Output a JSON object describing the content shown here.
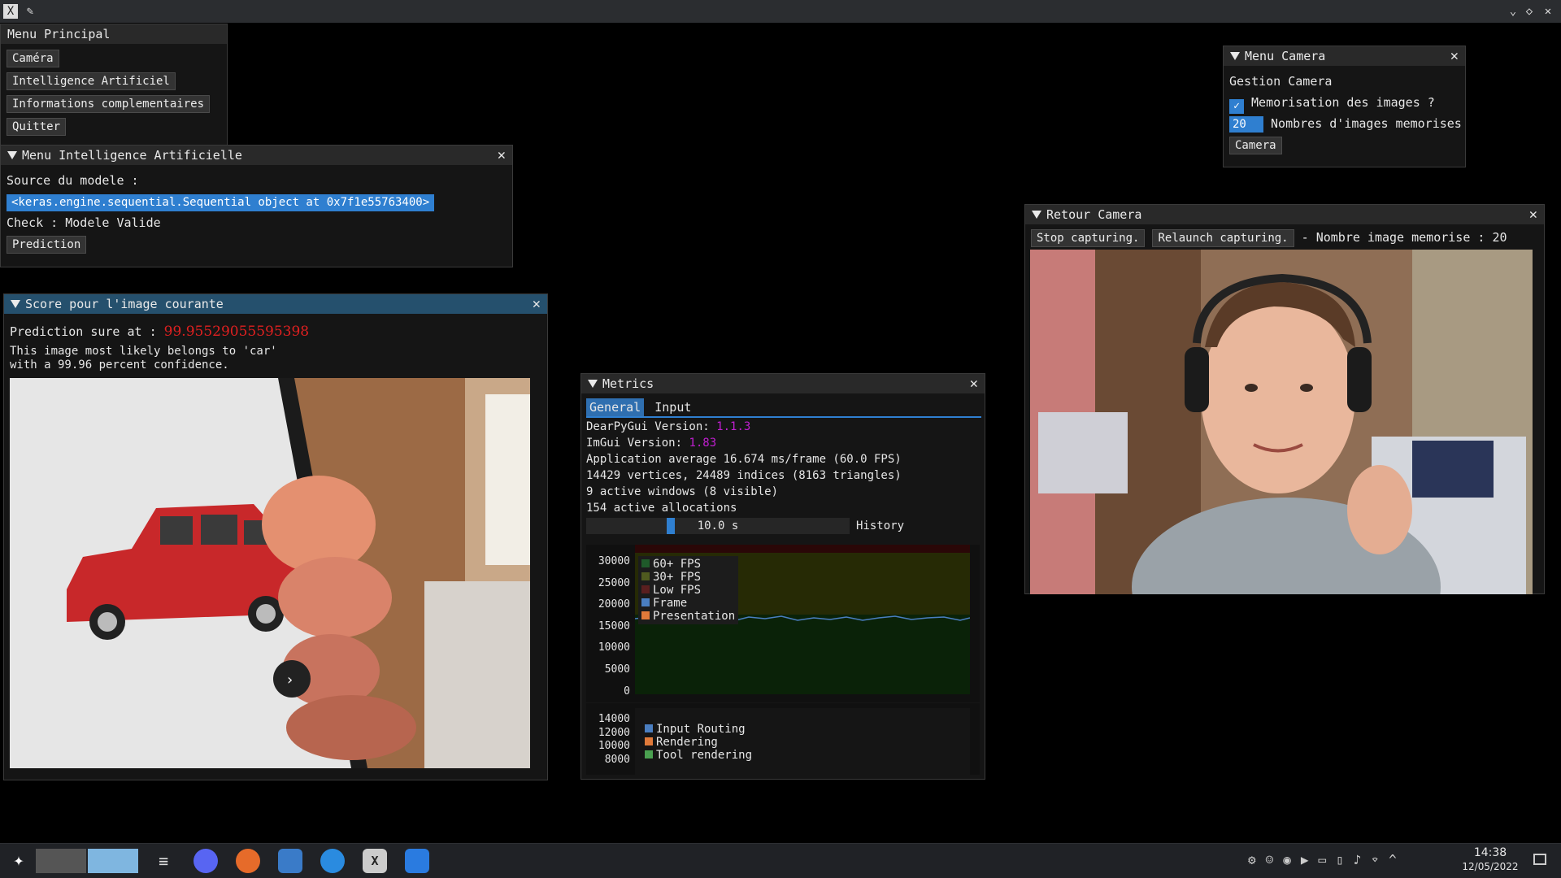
{
  "menu_principal": {
    "title": "Menu Principal",
    "buttons": [
      "Caméra",
      "Intelligence Artificiel",
      "Informations complementaires",
      "Quitter"
    ]
  },
  "menu_ia": {
    "title": "Menu Intelligence Artificielle",
    "source_label": "Source du modele :",
    "source_value": "<keras.engine.sequential.Sequential object at 0x7f1e55763400>",
    "check_label": "Check : Modele Valide",
    "prediction_button": "Prediction"
  },
  "score": {
    "title": "Score pour l'image courante",
    "prediction_label": "Prediction sure at :",
    "prediction_value": "99.95529055595398",
    "message_line1": "This image most likely belongs to 'car'",
    "message_line2": "with a 99.96 percent confidence."
  },
  "menu_camera": {
    "title": "Menu Camera",
    "section": "Gestion Camera",
    "checkbox_label": "Memorisation des images ?",
    "input_value": "20",
    "input_label": "Nombres d'images memorises",
    "button": "Camera"
  },
  "retour_camera": {
    "title": "Retour Camera",
    "stop_button": "Stop capturing.",
    "relaunch_button": "Relaunch capturing.",
    "count_text": "- Nombre image memorise : 20"
  },
  "metrics": {
    "title": "Metrics",
    "tabs": [
      "General",
      "Input"
    ],
    "dpg_label": "DearPyGui Version:",
    "dpg_version": "1.1.3",
    "imgui_label": "ImGui Version:",
    "imgui_version": "1.83",
    "avg": "Application average 16.674 ms/frame (60.0 FPS)",
    "verts": "14429 vertices, 24489 indices (8163 triangles)",
    "windows": "9 active windows (8 visible)",
    "allocs": "154 active allocations",
    "slider_value": "10.0 s",
    "history_label": "History",
    "plot1_yticks": [
      "30000",
      "25000",
      "20000",
      "15000",
      "10000",
      "5000",
      "0"
    ],
    "plot1_legend": [
      "60+ FPS",
      "30+ FPS",
      "Low FPS",
      "Frame",
      "Presentation"
    ],
    "plot2_yticks": [
      "14000",
      "12000",
      "10000",
      "8000"
    ],
    "plot2_legend": [
      "Input Routing",
      "Rendering",
      "Tool rendering"
    ]
  },
  "taskbar": {
    "time": "14:38",
    "date": "12/05/2022"
  },
  "colors": {
    "accent": "#2f7fd0",
    "active_title": "#25506d",
    "confidence": "#e02020",
    "version": "#c01fd0"
  }
}
